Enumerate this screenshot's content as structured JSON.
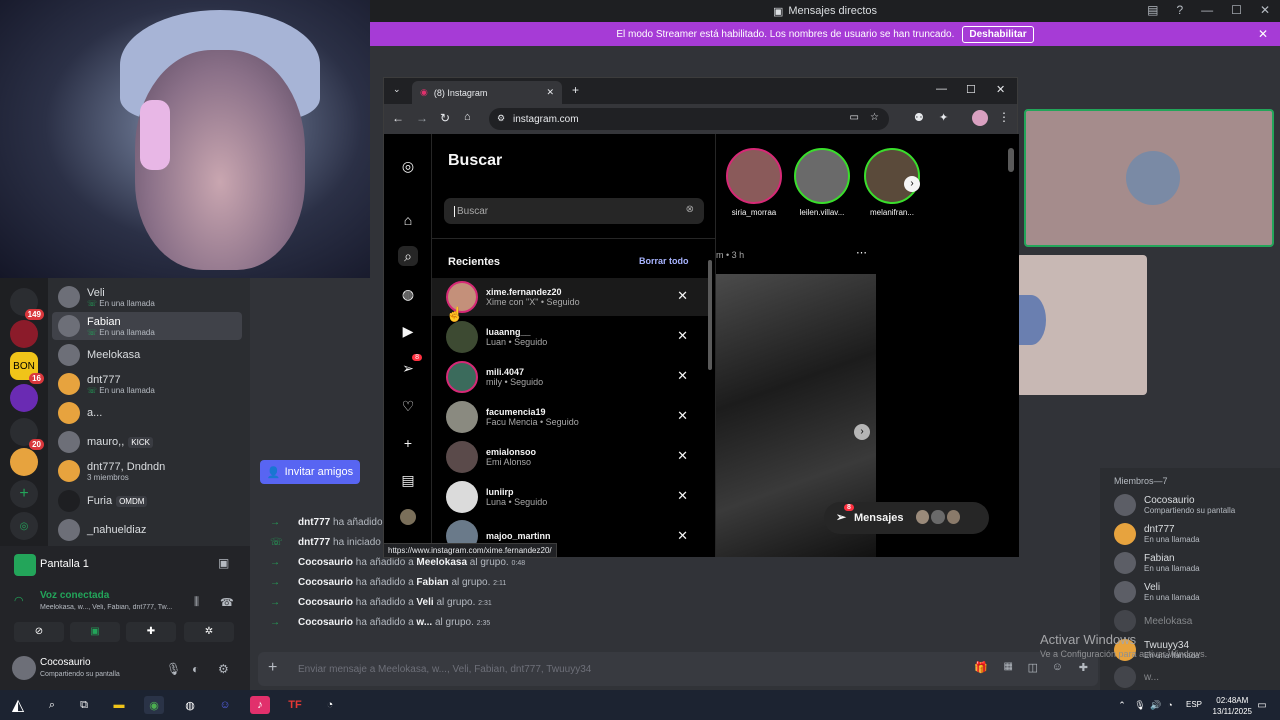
{
  "discord": {
    "title": "Mensajes directos",
    "streamer_banner": "El modo Streamer está habilitado. Los nombres de usuario se han truncado.",
    "streamer_button": "Deshabilitar",
    "servers": [
      {
        "badge": "149"
      },
      {
        "badge": ""
      },
      {
        "badge": "16"
      },
      {
        "badge": ""
      },
      {
        "badge": "20"
      },
      {
        "badge": ""
      }
    ],
    "dms": [
      {
        "name": "Veli",
        "status": "En una llamada"
      },
      {
        "name": "Fabian",
        "status": "En una llamada"
      },
      {
        "name": "Meelokasa",
        "status": ""
      },
      {
        "name": "dnt777",
        "status": "En una llamada"
      },
      {
        "name": "a...",
        "status": ""
      },
      {
        "name": "mauro,,",
        "status": "",
        "tag": "KICK"
      },
      {
        "name": "dnt777, Dndndn",
        "status": "3 miembros"
      },
      {
        "name": "Furia",
        "status": "",
        "tag": "OMDM"
      },
      {
        "name": "_nahueldiaz",
        "status": ""
      }
    ],
    "screen_panel": {
      "title": "Pantalla 1",
      "voice_status": "Voz conectada",
      "voice_members": "Meelokasa, w..., Veli, Fabian, dnt777, Tw...",
      "user": "Cocosaurio",
      "user_status": "Compartiendo su pantalla"
    },
    "invite_button": "Invitar amigos",
    "messages": [
      {
        "actor": "dnt777",
        "text": "ha añadido",
        "target": "",
        "suffix": "",
        "time": "",
        "type": "add"
      },
      {
        "actor": "dnt777",
        "text": "ha iniciado",
        "target": "",
        "suffix": "",
        "time": "",
        "type": "call"
      },
      {
        "actor": "Cocosaurio",
        "text": "ha añadido a",
        "target": "Meelokasa",
        "suffix": "al grupo.",
        "time": "0:48",
        "type": "add"
      },
      {
        "actor": "Cocosaurio",
        "text": "ha añadido a",
        "target": "Fabian",
        "suffix": "al grupo.",
        "time": "2:11",
        "type": "add"
      },
      {
        "actor": "Cocosaurio",
        "text": "ha añadido a",
        "target": "Veli",
        "suffix": "al grupo.",
        "time": "2:31",
        "type": "add"
      },
      {
        "actor": "Cocosaurio",
        "text": "ha añadido a",
        "target": "w...",
        "suffix": "al grupo.",
        "time": "2:35",
        "type": "add"
      }
    ],
    "composer_placeholder": "Enviar mensaje a Meelokasa, w..., Veli, Fabian, dnt777, Twuuyy34",
    "members_header": "Miembros—7",
    "members": [
      {
        "name": "Cocosaurio",
        "status": "Compartiendo su pantalla"
      },
      {
        "name": "dnt777",
        "status": "En una llamada"
      },
      {
        "name": "Fabian",
        "status": "En una llamada"
      },
      {
        "name": "Veli",
        "status": "En una llamada"
      },
      {
        "name": "Meelokasa",
        "status": ""
      },
      {
        "name": "Twuuyy34",
        "status": "En una llamada"
      },
      {
        "name": "w...",
        "status": ""
      }
    ],
    "activate_title": "Activar Windows",
    "activate_sub": "Ve a Configuración para activar Windows."
  },
  "chrome": {
    "tab_title": "(8) Instagram",
    "url": "instagram.com",
    "status_url": "https://www.instagram.com/xime.fernandez20/"
  },
  "instagram": {
    "search_title": "Buscar",
    "search_placeholder": "Buscar",
    "recent_label": "Recientes",
    "clear_all": "Borrar todo",
    "notif_badge": "8",
    "recents": [
      {
        "username": "xime.fernandez20",
        "fullname": "Xime con \"X\" • Seguido"
      },
      {
        "username": "luaanng__",
        "fullname": "Luan • Seguido"
      },
      {
        "username": "mili.4047",
        "fullname": "mily • Seguido"
      },
      {
        "username": "facumencia19",
        "fullname": "Facu Mencia • Seguido"
      },
      {
        "username": "emialonsoo",
        "fullname": "Emi Alonso"
      },
      {
        "username": "luniirp",
        "fullname": "Luna • Seguido"
      },
      {
        "username": "majoo_martinn",
        "fullname": ""
      }
    ],
    "stories": [
      {
        "label": "siria_morraa"
      },
      {
        "label": "leilen.villav..."
      },
      {
        "label": "melanifran..."
      }
    ],
    "post_meta": "m • 3 h",
    "messages_button": "Mensajes",
    "messages_badge": "8"
  },
  "taskbar": {
    "lang": "ESP",
    "time": "02:48AM",
    "date": "13/11/2025"
  }
}
